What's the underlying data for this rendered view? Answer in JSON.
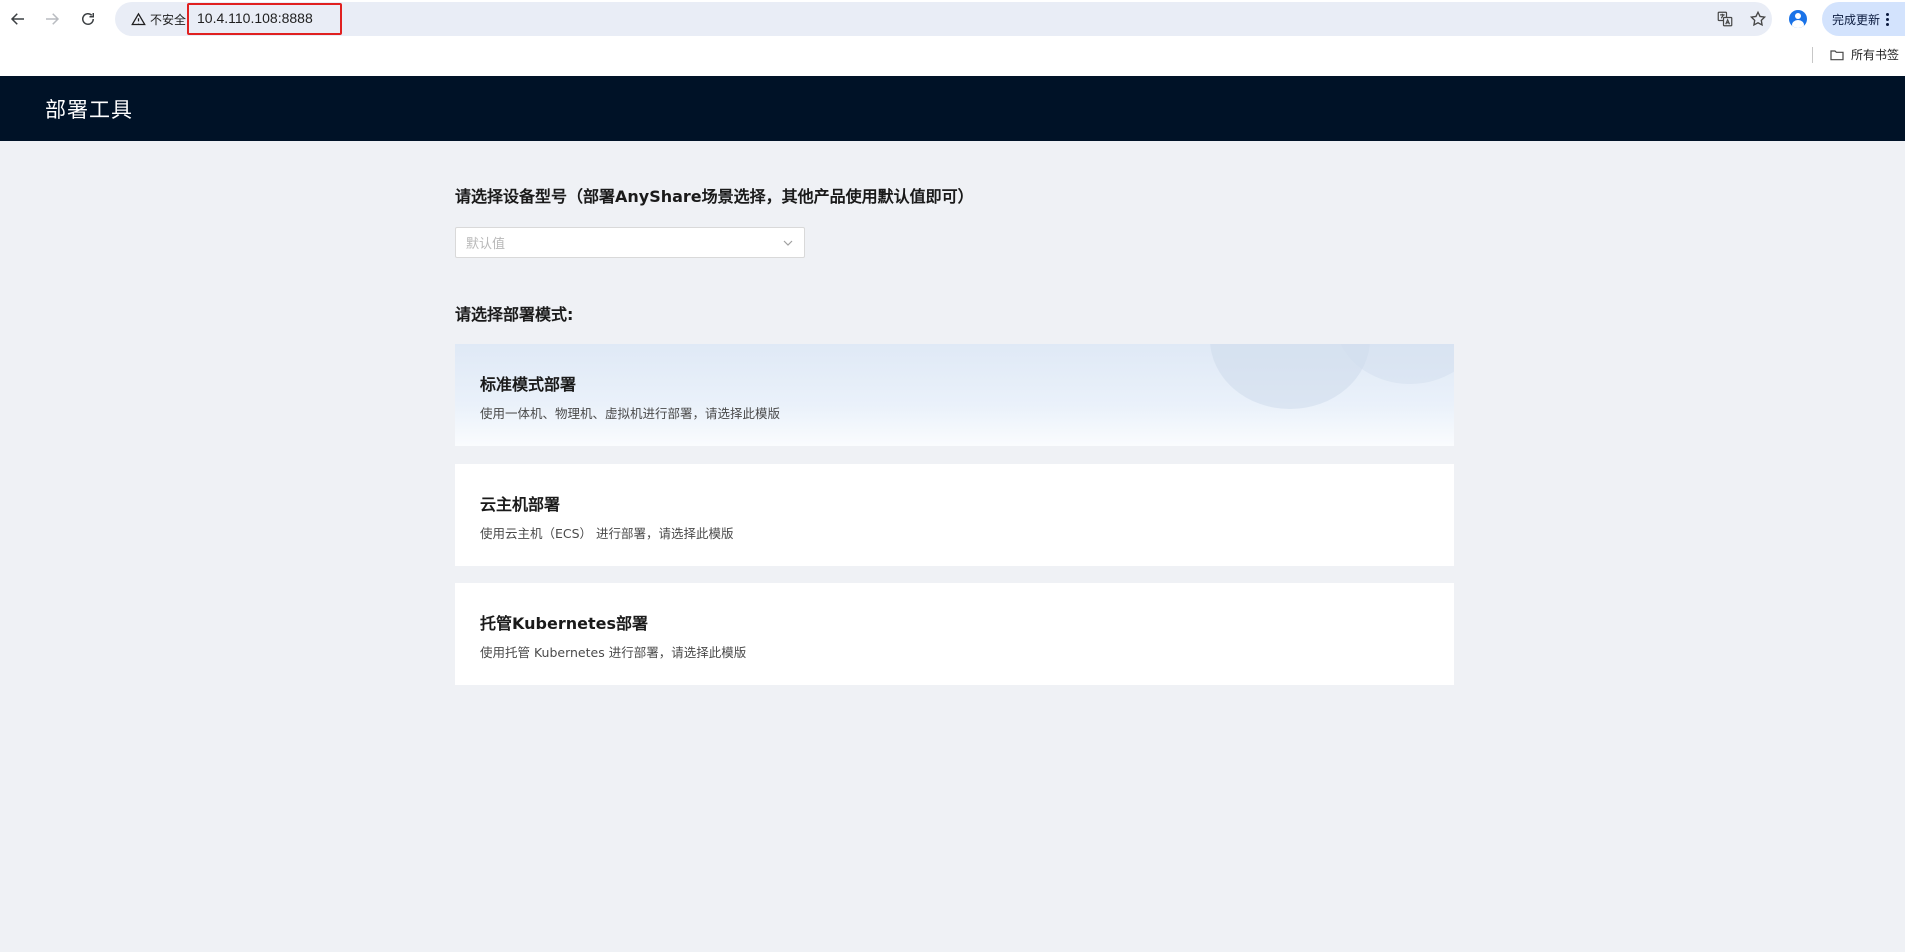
{
  "browser": {
    "security_label": "不安全",
    "url": "10.4.110.108:8888",
    "update_label": "完成更新",
    "bookmarks_all_label": "所有书签"
  },
  "app": {
    "title": "部署工具"
  },
  "form": {
    "device_label": "请选择设备型号（部署AnyShare场景选择，其他产品使用默认值即可）",
    "device_select_placeholder": "默认值",
    "mode_label": "请选择部署模式:"
  },
  "modes": [
    {
      "title": "标准模式部署",
      "desc": "使用一体机、物理机、虚拟机进行部署，请选择此模版",
      "selected": true
    },
    {
      "title": "云主机部署",
      "desc": "使用云主机（ECS） 进行部署，请选择此模版",
      "selected": false
    },
    {
      "title": "托管Kubernetes部署",
      "desc": "使用托管 Kubernetes 进行部署，请选择此模版",
      "selected": false
    }
  ],
  "colors": {
    "header_bg": "#001227",
    "page_bg": "#eff1f5",
    "url_highlight": "#e02020"
  }
}
